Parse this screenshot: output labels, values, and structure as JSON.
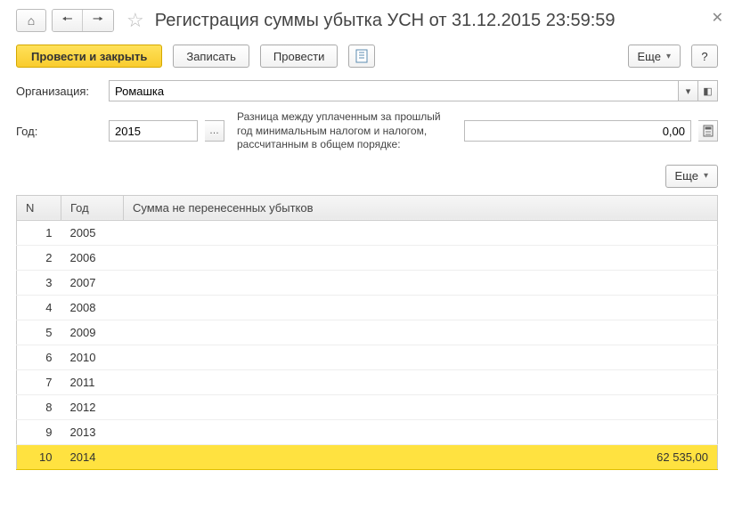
{
  "header": {
    "title": "Регистрация суммы убытка УСН от 31.12.2015 23:59:59"
  },
  "toolbar": {
    "post_close": "Провести и закрыть",
    "save": "Записать",
    "post": "Провести",
    "more": "Еще",
    "help": "?"
  },
  "form": {
    "org_label": "Организация:",
    "org_value": "Ромашка",
    "year_label": "Год:",
    "year_value": "2015",
    "diff_label": "Разница между уплаченным за прошлый год минимальным налогом и налогом, рассчитанным в общем порядке:",
    "diff_value": "0,00"
  },
  "table": {
    "col_n": "N",
    "col_year": "Год",
    "col_sum": "Сумма не перенесенных убытков",
    "rows": [
      {
        "n": "1",
        "year": "2005",
        "sum": ""
      },
      {
        "n": "2",
        "year": "2006",
        "sum": ""
      },
      {
        "n": "3",
        "year": "2007",
        "sum": ""
      },
      {
        "n": "4",
        "year": "2008",
        "sum": ""
      },
      {
        "n": "5",
        "year": "2009",
        "sum": ""
      },
      {
        "n": "6",
        "year": "2010",
        "sum": ""
      },
      {
        "n": "7",
        "year": "2011",
        "sum": ""
      },
      {
        "n": "8",
        "year": "2012",
        "sum": ""
      },
      {
        "n": "9",
        "year": "2013",
        "sum": ""
      },
      {
        "n": "10",
        "year": "2014",
        "sum": "62 535,00",
        "selected": true
      }
    ]
  }
}
